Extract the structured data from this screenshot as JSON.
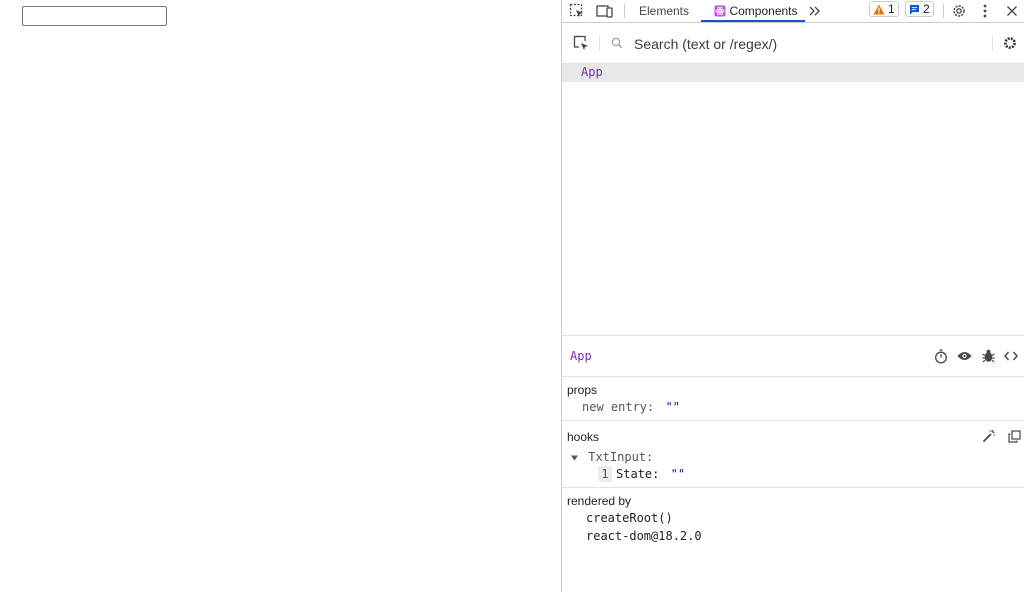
{
  "page": {
    "input_value": ""
  },
  "devtools": {
    "tabs": {
      "elements": "Elements",
      "components": "Components"
    },
    "badges": {
      "warnings": "1",
      "messages": "2"
    },
    "search": {
      "placeholder": "Search (text or /regex/)"
    },
    "tree": {
      "items": [
        {
          "label": "App"
        }
      ]
    },
    "inspector": {
      "title": "App",
      "props": {
        "title": "props",
        "items": [
          {
            "key": "new entry",
            "value": "\"\""
          }
        ]
      },
      "hooks": {
        "title": "hooks",
        "items": [
          {
            "name": "TxtInput",
            "index": "1",
            "key": "State",
            "value": "\"\""
          }
        ]
      },
      "rendered_by": {
        "title": "rendered by",
        "items": [
          "createRoot()",
          "react-dom@18.2.0"
        ]
      }
    },
    "colors": {
      "accent": "#0b57d0",
      "component_name": "#6b32b4",
      "string_value": "#1a1aa6",
      "selected_row": "#e8e8e8"
    }
  }
}
